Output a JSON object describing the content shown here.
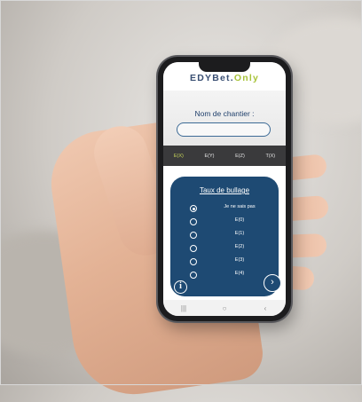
{
  "app": {
    "logo_part1": "EDYBet.",
    "logo_part2": "Only"
  },
  "form": {
    "site_label": "Nom de chantier :",
    "site_value": ""
  },
  "tabs": [
    {
      "label": "E(X)",
      "active": true
    },
    {
      "label": "E(Y)",
      "active": false
    },
    {
      "label": "E(Z)",
      "active": false
    },
    {
      "label": "T(X)",
      "active": false
    }
  ],
  "panel": {
    "title": "Taux de bullage",
    "options": [
      {
        "label": "Je ne sais pas",
        "checked": true
      },
      {
        "label": "E(0)",
        "checked": false
      },
      {
        "label": "E(1)",
        "checked": false
      },
      {
        "label": "E(2)",
        "checked": false
      },
      {
        "label": "E(3)",
        "checked": false
      },
      {
        "label": "E(4)",
        "checked": false
      }
    ],
    "info_icon": "i",
    "next_icon": "›"
  },
  "navbar": {
    "recent": "|||",
    "home": "○",
    "back": "‹"
  },
  "colors": {
    "panel": "#1e4a73",
    "accent": "#a8c33a",
    "logo_dark": "#3a4f73",
    "tab_bar": "#3a3a3c"
  }
}
